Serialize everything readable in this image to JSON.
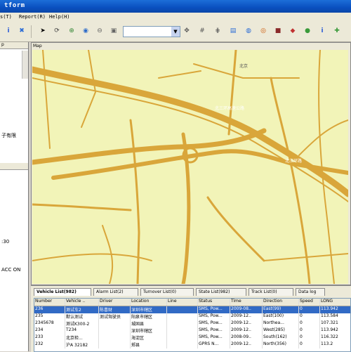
{
  "window": {
    "title": "tform"
  },
  "menu": [
    {
      "label": "s(T)",
      "x": 0
    },
    {
      "label": "Report(R)",
      "x": 27
    },
    {
      "label": "Help(H)",
      "x": 70
    }
  ],
  "left_panel": {
    "top_tab": "p",
    "lines_top": [
      "子有限"
    ],
    "lines_bottom": [
      ":30",
      "ACC ON"
    ]
  },
  "map": {
    "tab_label": "Map",
    "road_labels": [
      "北京",
      "北三环高速公路",
      "北三环路"
    ]
  },
  "bottom_tabs": [
    {
      "label": "Vehicle List(982)",
      "active": true
    },
    {
      "label": "Alarm List(2)",
      "active": false
    },
    {
      "label": "Turnover List(0)",
      "active": false
    },
    {
      "label": "State List(982)",
      "active": false
    },
    {
      "label": "Track List(0)",
      "active": false
    },
    {
      "label": "Data log",
      "active": false
    }
  ],
  "table": {
    "columns": [
      "Number",
      "Vehicle ..",
      "Driver",
      "Location",
      "Line",
      "Status",
      "Time",
      "Direction",
      "Speed",
      "LONG"
    ],
    "rows": [
      [
        "236",
        "测试车2",
        "陈喜财",
        "深圳市辖区",
        "",
        "SMS, Pow...",
        "2009-08..",
        "East(99)",
        "0",
        "113.942"
      ],
      [
        "235",
        "默认测试",
        "测试驾驶员",
        "阳泉市辖区",
        "",
        "SMS, Pow...",
        "2009-12..",
        "East(100)",
        "0",
        "113.584"
      ],
      [
        "2345678",
        "测试K300-2",
        "",
        "城固县",
        "",
        "SMS, Pow...",
        "2009-12..",
        "Northea...",
        "0",
        "107.321"
      ],
      [
        "234",
        "T234",
        "",
        "深圳市辖区",
        "",
        "SMS, Pow...",
        "2009-12..",
        "West(285)",
        "0",
        "113.942"
      ],
      [
        "233",
        "北京检...",
        "",
        "海淀区",
        "",
        "SMS, Pow...",
        "2008-09..",
        "South(162)",
        "0",
        "116.322"
      ],
      [
        "232",
        "沪A 32182",
        "",
        "郏县",
        "",
        "GPRS N...",
        "2009-12..",
        "North(356)",
        "0",
        "113.2"
      ]
    ]
  },
  "icons": [
    "info-icon",
    "cross-icon",
    "pointer-icon",
    "refresh-icon",
    "zoom-in-icon",
    "globe-icon",
    "zoom-out-icon",
    "fullscreen-icon",
    "rotate-icon",
    "grid-icon",
    "layer-icon",
    "table-icon",
    "bars-icon",
    "ring-icon",
    "car-icon",
    "camera-icon",
    "shield-icon",
    "leaf-icon",
    "info-icon"
  ]
}
